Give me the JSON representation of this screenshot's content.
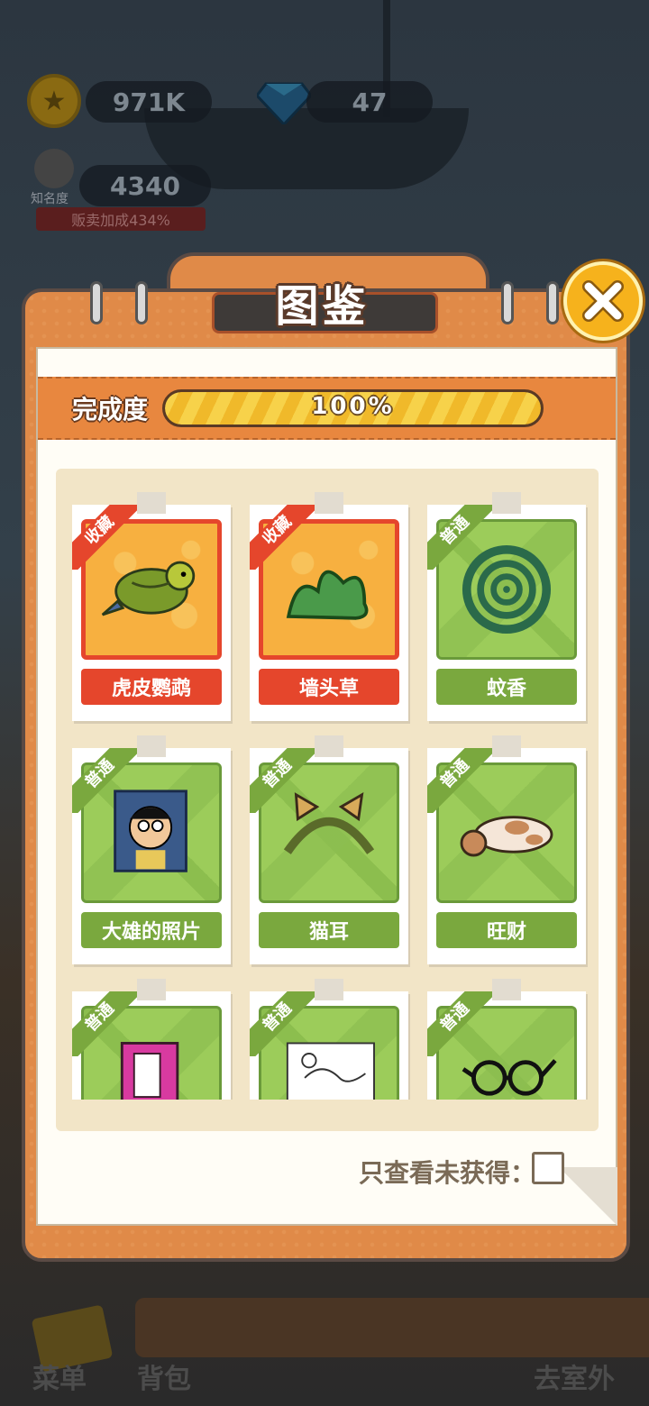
{
  "hud": {
    "coins": "971K",
    "gems": "47",
    "fame_label": "知名度",
    "fame": "4340",
    "bonus": "贩卖加成434%"
  },
  "modal": {
    "title": "图鉴",
    "progress_label": "完成度",
    "progress_text": "100%",
    "progress_fraction": 1.0,
    "filter_label": "只查看未获得：",
    "filter_checked": false
  },
  "collection": {
    "items": [
      {
        "name": "虎皮鹦鹉",
        "tag": "收藏",
        "rarity": "rare",
        "icon": "budgie-icon"
      },
      {
        "name": "墙头草",
        "tag": "收藏",
        "rarity": "rare",
        "icon": "grass-icon"
      },
      {
        "name": "蚊香",
        "tag": "普通",
        "rarity": "common",
        "icon": "mosquito-coil-icon"
      },
      {
        "name": "大雄的照片",
        "tag": "普通",
        "rarity": "common",
        "icon": "photo-icon"
      },
      {
        "name": "猫耳",
        "tag": "普通",
        "rarity": "common",
        "icon": "cat-ears-icon"
      },
      {
        "name": "旺财",
        "tag": "普通",
        "rarity": "common",
        "icon": "dog-icon"
      },
      {
        "name": "",
        "tag": "普通",
        "rarity": "common",
        "icon": "book-icon"
      },
      {
        "name": "",
        "tag": "普通",
        "rarity": "common",
        "icon": "drawing-icon"
      },
      {
        "name": "",
        "tag": "普通",
        "rarity": "common",
        "icon": "glasses-icon"
      }
    ]
  },
  "bottom_nav": {
    "menu": "菜单",
    "bag": "背包",
    "go_outside": "去室外"
  },
  "colors": {
    "panel": "#e08a48",
    "rare": "#e5462c",
    "common": "#7aa83e",
    "close": "#f6b21c"
  }
}
